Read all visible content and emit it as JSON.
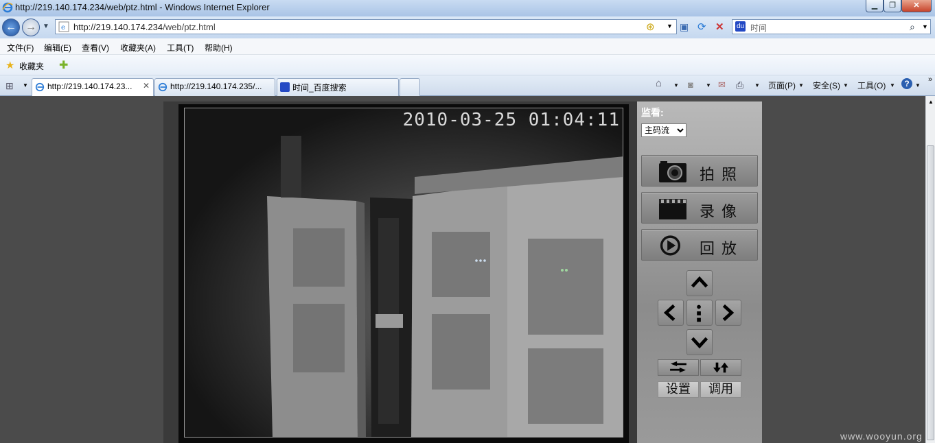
{
  "window": {
    "title": "http://219.140.174.234/web/ptz.html - Windows Internet Explorer"
  },
  "address": {
    "url_prefix": "http://219.140.174.234",
    "url_path": "/web/ptz.html"
  },
  "search": {
    "value": "时间"
  },
  "menu": [
    "文件(F)",
    "编辑(E)",
    "查看(V)",
    "收藏夹(A)",
    "工具(T)",
    "帮助(H)"
  ],
  "favorites": {
    "label": "收藏夹"
  },
  "tabs": [
    {
      "label": "http://219.140.174.23...",
      "active": true
    },
    {
      "label": "http://219.140.174.235/...",
      "active": false
    },
    {
      "label": "时间_百度搜索",
      "active": false
    }
  ],
  "toolbar": {
    "page": "页面(P)",
    "safety": "安全(S)",
    "tools": "工具(O)"
  },
  "video": {
    "timestamp": "2010-03-25 01:04:11"
  },
  "controls": {
    "monitor_label": "监看:",
    "stream_selected": "主码流",
    "snapshot": "拍照",
    "record": "录像",
    "playback": "回放",
    "set_preset": "设置",
    "call_preset": "调用"
  },
  "watermark": "www.wooyun.org"
}
